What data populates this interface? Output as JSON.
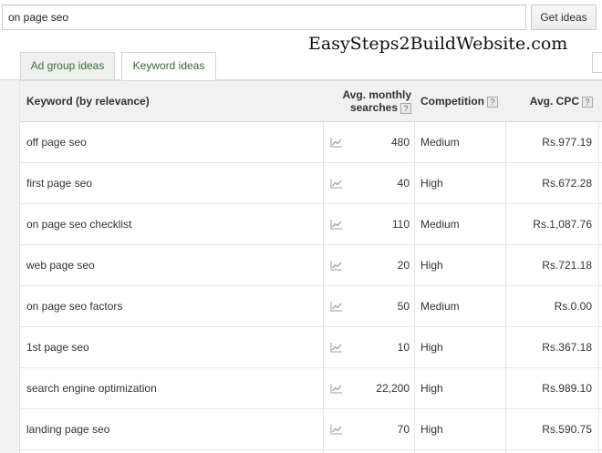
{
  "search": {
    "value": "on page seo",
    "button_label": "Get ideas"
  },
  "watermark": "EasySteps2BuildWebsite.com",
  "tabs": [
    {
      "label": "Ad group ideas",
      "active": false
    },
    {
      "label": "Keyword ideas",
      "active": true
    }
  ],
  "table": {
    "headers": {
      "keyword": "Keyword (by relevance)",
      "searches_line1": "Avg. monthly",
      "searches_line2": "searches",
      "competition": "Competition",
      "cpc": "Avg. CPC",
      "help_glyph": "?"
    },
    "trend_icon": "line-chart-icon",
    "rows": [
      {
        "keyword": "off page seo",
        "searches": "480",
        "competition": "Medium",
        "cpc": "Rs.977.19"
      },
      {
        "keyword": "first page seo",
        "searches": "40",
        "competition": "High",
        "cpc": "Rs.672.28"
      },
      {
        "keyword": "on page seo checklist",
        "searches": "110",
        "competition": "Medium",
        "cpc": "Rs.1,087.76"
      },
      {
        "keyword": "web page seo",
        "searches": "20",
        "competition": "High",
        "cpc": "Rs.721.18"
      },
      {
        "keyword": "on page seo factors",
        "searches": "50",
        "competition": "Medium",
        "cpc": "Rs.0.00"
      },
      {
        "keyword": "1st page seo",
        "searches": "10",
        "competition": "High",
        "cpc": "Rs.367.18"
      },
      {
        "keyword": "search engine optimization",
        "searches": "22,200",
        "competition": "High",
        "cpc": "Rs.989.10"
      },
      {
        "keyword": "landing page seo",
        "searches": "70",
        "competition": "High",
        "cpc": "Rs.590.75"
      }
    ]
  },
  "colors": {
    "tab_text": "#2f6a2f",
    "header_bg": "#f1f1f1",
    "row_border": "#e6e6e6"
  }
}
